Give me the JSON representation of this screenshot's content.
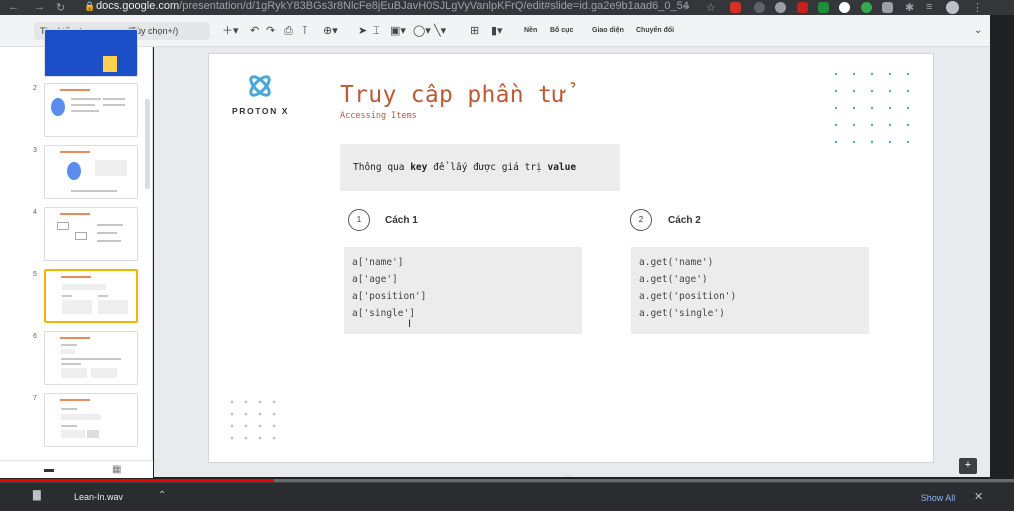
{
  "browser": {
    "url_host": "docs.google.com",
    "url_path": "/presentation/d/1gRykY83BGs3r8NlcFe8jEuBJavH0SJLgVyVanlpKFrQ/edit#slide=id.ga2e9b1aad6_0_54"
  },
  "toolbar": {
    "search_menu": "Tìm kiếm trong menu (Tùy chọn+/)",
    "background_label": "Nền",
    "layout_label": "Bố cục",
    "theme_label": "Giao diện",
    "transition_label": "Chuyển đổi"
  },
  "thumbnails": [
    {
      "number": "2"
    },
    {
      "number": "3"
    },
    {
      "number": "4"
    },
    {
      "number": "5",
      "selected": true
    },
    {
      "number": "6"
    },
    {
      "number": "7"
    }
  ],
  "slide": {
    "brand": "PROTON X",
    "title": "Truy cập phần tử",
    "subtitle": "Accessing Items",
    "info": {
      "prefix": "Thông qua ",
      "key": "key",
      "middle": " để lấy được giá trị ",
      "value": "value"
    },
    "method1": {
      "num": "1",
      "label": "Cách 1",
      "lines": [
        "a['name']",
        "a['age']",
        "a['position']",
        "a['single']"
      ]
    },
    "method2": {
      "num": "2",
      "label": "Cách 2",
      "lines": [
        "a.get('name')",
        "a.get('age')",
        "a.get('position')",
        "a.get('single')"
      ]
    }
  },
  "downloads": {
    "file_name": "Lean-In.wav",
    "show_all": "Show All"
  },
  "video_progress": 0.27,
  "colors": {
    "accent": "#c05a35",
    "dots": "#4aa8d8",
    "selection": "#f4b400",
    "progress": "#ff0000"
  }
}
